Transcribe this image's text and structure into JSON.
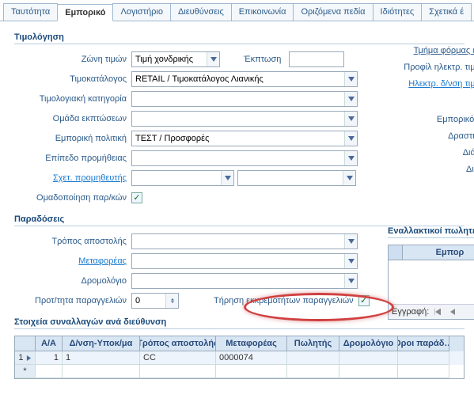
{
  "tabs": {
    "identity": "Ταυτότητα",
    "commercial": "Εμπορικό",
    "accounting": "Λογιστήριο",
    "addresses": "Διευθύνσεις",
    "contact": "Επικοινωνία",
    "custom": "Οριζόμενα πεδία",
    "properties": "Ιδιότητες",
    "related": "Σχετικά έ"
  },
  "pricing": {
    "section": "Τιμολόγηση",
    "zone_label": "Ζώνη τιμών",
    "zone_value": "Τιμή χονδρικής",
    "discount_label": "Έκπτωση",
    "discount_value": "",
    "catalog_label": "Τιμοκατάλογος",
    "catalog_value": "RETAIL / Τιμοκατάλογος Λιανικής",
    "inv_category_label": "Τιμολογιακή κατηγορία",
    "inv_category_value": "",
    "discount_group_label": "Ομάδα εκπτώσεων",
    "discount_group_value": "",
    "com_policy_label": "Εμπορική πολιτική",
    "com_policy_value": "ΤΕΣΤ / Προσφορές",
    "commission_label": "Επίπεδο προμήθειας",
    "commission_value": "",
    "rel_supplier_label": "Σχετ. προμηθευτής",
    "rel_supplier_value": "",
    "rel_supplier_extra": "",
    "group_batch_label": "Ομαδοποίηση παρ/κών"
  },
  "right": {
    "form_section": "Τμήμα φόρμας εντ",
    "eprofile": "Προφίλ ηλεκτρ. τιμολ",
    "eaddress": "Ηλεκτρ. δ/νση τιμολ",
    "com_to": "Εμπορικός τ",
    "activity": "Δραστηρι",
    "dimension": "Διάστ",
    "dimension2": "Διάσ"
  },
  "deliveries": {
    "section": "Παραδόσεις",
    "ship_label": "Τρόπος αποστολής",
    "ship_value": "",
    "carrier_label": "Μεταφορέας",
    "carrier_value": "",
    "route_label": "Δρομολόγιο",
    "route_value": "",
    "priority_label": "Προτ/τητα παραγγελιών",
    "priority_value": "0",
    "backorder_label": "Τήρηση εκκρεμοτήτων παραγγελιών"
  },
  "alt": {
    "section": "Εναλλακτικοί πωλητέ",
    "header": "Εμπορ",
    "footer_label": "Εγγραφή:"
  },
  "trans": {
    "section": "Στοιχεία συναλλαγών ανά διεύθυνση",
    "headers": {
      "idx": "Α/Α",
      "dn": "Δ/νση-Υποκ/μα",
      "ship": "Τρόπος αποστολής",
      "carrier": "Μεταφορέας",
      "seller": "Πωλητής",
      "route": "Δρομολόγιο",
      "terms": "Όροι παράδ…"
    },
    "rows": [
      {
        "idx": "1",
        "dn": "1",
        "ship": "CC",
        "carrier": "0000074",
        "seller": "",
        "route": "",
        "terms": ""
      }
    ]
  }
}
